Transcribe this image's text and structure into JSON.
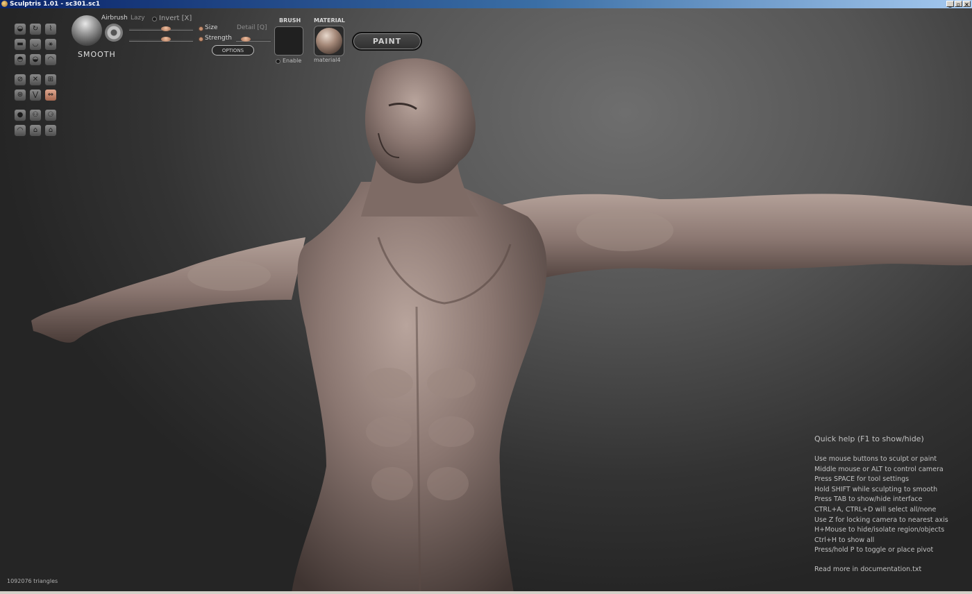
{
  "window": {
    "title": "Sculptris 1.01 - sc301.sc1",
    "controls": {
      "minimize": "_",
      "restore": "▫",
      "close": "×"
    }
  },
  "brush_panel": {
    "tool_name": "SMOOTH",
    "airbrush_label": "Airbrush",
    "lazy_label": "Lazy",
    "invert_label": "Invert [X]",
    "size_label": "Size",
    "strength_label": "Strength",
    "detail_label": "Detail [Q]",
    "options_label": "OPTIONS"
  },
  "brush_slot": {
    "header": "BRUSH",
    "enable_label": "Enable"
  },
  "material_slot": {
    "header": "MATERIAL",
    "name": "material4"
  },
  "paint_button": {
    "label": "PAINT"
  },
  "tool_palette": {
    "row1": [
      "draw-icon",
      "rotate-icon",
      "inflate-icon"
    ],
    "row2": [
      "flatten-icon",
      "crease-icon",
      "pinch-icon"
    ],
    "row3": [
      "grab-icon",
      "scale-icon",
      "smooth-icon"
    ],
    "row4": [
      "symmetry-icon",
      "wireframe-icon",
      "grid-icon"
    ],
    "row5": [
      "reduce-icon",
      "mask-icon",
      "mirror-axis-icon"
    ],
    "row6": [
      "new-sphere-icon",
      "open-icon",
      "save-icon"
    ],
    "row7": [
      "import-icon",
      "export-icon",
      "settings-icon"
    ]
  },
  "quick_help": {
    "title": "Quick help (F1 to show/hide)",
    "lines": [
      "Use mouse buttons to sculpt or paint",
      "Middle mouse or ALT to control camera",
      "Press SPACE for tool settings",
      "Hold SHIFT while sculpting to smooth",
      "Press TAB to show/hide interface",
      "CTRL+A, CTRL+D will select all/none",
      "Use Z for locking camera to nearest axis",
      "H+Mouse to hide/isolate region/objects",
      "Ctrl+H to show all",
      "Press/hold P to toggle or place pivot"
    ],
    "more": "Read more in documentation.txt"
  },
  "status": {
    "triangles": "1092076 triangles"
  },
  "colors": {
    "model_skin": "#8a7670",
    "active_tool": "#c08468",
    "background_top": "#6e6e6e",
    "background_bottom": "#252525"
  }
}
